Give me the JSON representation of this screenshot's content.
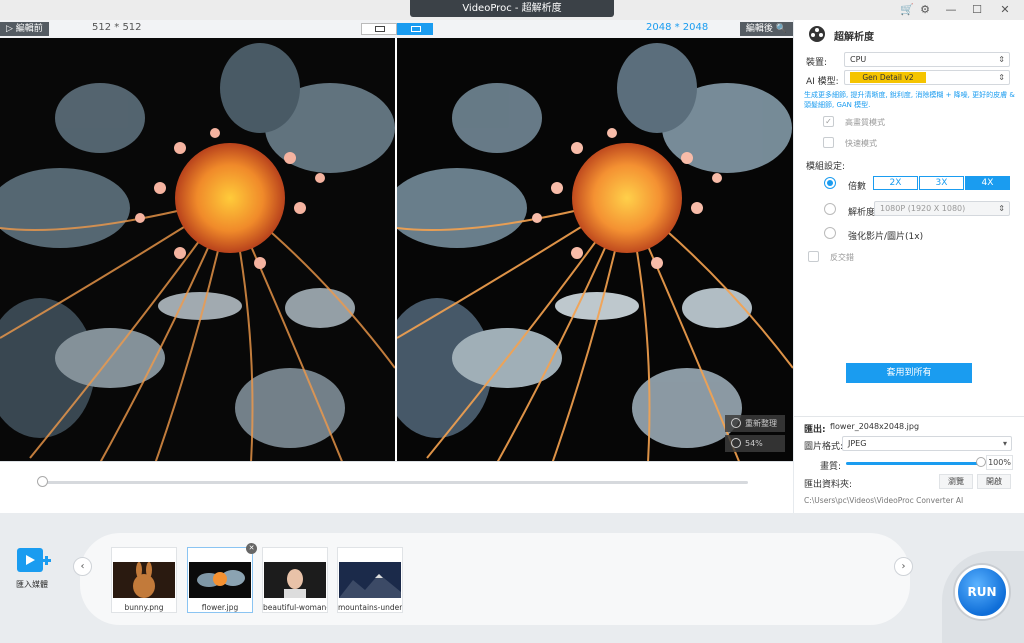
{
  "window": {
    "title": "VideoProc - 超解析度",
    "controls": {
      "cart": "🛒",
      "settings": "⚙",
      "minimize": "—",
      "maximize": "☐",
      "close": "✕"
    }
  },
  "preview": {
    "before_label": "▷ 編輯前",
    "after_label": "編輯後 🔍",
    "left_resolution": "512 * 512",
    "right_resolution": "2048 * 2048",
    "reorganize_label": "重新整理",
    "zoom_label": "54%",
    "slider_position": 0.0
  },
  "panel": {
    "title": "超解析度",
    "device_label": "裝置:",
    "device_value": "CPU",
    "model_label": "AI 模型:",
    "model_value": "Gen Detail v2",
    "description": "生成更多細節, 提升清晰度, 銳利度, 消除模糊 + 降噪, 更好的皮膚 & 頭髮細節, GAN 模型.",
    "hq_mode_label": "高畫質模式",
    "fast_mode_label": "快速模式",
    "model_settings_label": "模組設定:",
    "multiple_label": "倍數",
    "scale_options": [
      "2X",
      "3X",
      "4X"
    ],
    "selected_scale": "4X",
    "resolution_label": "解析度",
    "resolution_value": "1080P (1920 X 1080)",
    "enhance_label": "強化影片/圖片(1x)",
    "deinterlace_label": "反交錯",
    "apply_all_label": "套用到所有"
  },
  "export": {
    "label": "匯出:",
    "filename": "flower_2048x2048.jpg",
    "format_label": "圖片格式:",
    "format_value": "JPEG",
    "quality_label": "畫質:",
    "quality_value": "100%",
    "quality_level": 1.0,
    "folder_label": "匯出資料夾:",
    "browse_label": "瀏覽",
    "open_label": "開啟",
    "path": "C:\\Users\\pc\\Videos\\VideoProc Converter AI"
  },
  "bottom": {
    "import_label": "匯入媒體",
    "run_label": "RUN",
    "thumbnails": [
      {
        "name": "bunny.png"
      },
      {
        "name": "flower.jpg"
      },
      {
        "name": "beautiful-woman-"
      },
      {
        "name": "mountains-under-"
      }
    ]
  },
  "colors": {
    "accent": "#1a9cf0",
    "model_badge": "#f5c400",
    "title_bar": "#3b4147"
  }
}
